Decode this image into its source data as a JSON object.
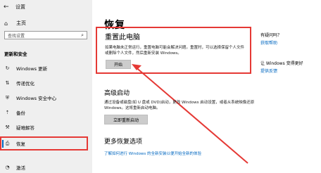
{
  "app": {
    "back_arrow": "←",
    "title": "设置"
  },
  "sidebar": {
    "home": {
      "icon": "home-icon",
      "glyph": "⌂",
      "label": "主页"
    },
    "search": {
      "placeholder": "查找设置",
      "icon": "search-icon",
      "glyph": "⌕"
    },
    "section_title": "更新和安全",
    "items": [
      {
        "icon": "refresh-icon",
        "glyph": "↻",
        "label": "Windows 更新"
      },
      {
        "icon": "delivery-optimization-icon",
        "glyph": "⇅",
        "label": "传递优化"
      },
      {
        "icon": "shield-icon",
        "glyph": "⛨",
        "label": "Windows 安全中心"
      },
      {
        "icon": "backup-icon",
        "glyph": "⇡",
        "label": "备份"
      },
      {
        "icon": "wrench-icon",
        "glyph": "⚒",
        "label": "疑难解答"
      },
      {
        "icon": "recovery-icon",
        "glyph": "⎙",
        "label": "恢复"
      },
      {
        "icon": "activation-icon",
        "glyph": "◔",
        "label": "激活"
      }
    ],
    "selected_index": 5
  },
  "main": {
    "title": "恢复",
    "reset": {
      "heading": "重置此电脑",
      "description": "如果电脑未正常运行，重置电脑可能会解决问题。重置时，可以选择保留个人文件或删除个人文件，然后重新安装 Windows。",
      "button": "开始"
    },
    "advanced": {
      "heading": "高级启动",
      "description": "通过设备或磁盘(如 U 盘或 DVD)启动，更改 Windows 启动设置，或者从系统映像还原 Windows。这将重新启动电脑。",
      "button": "立即重新启动"
    },
    "more": {
      "heading": "更多恢复选项",
      "link": "了解如何进行 Windows 的全新安装以便开始全新的体验"
    }
  },
  "right_panel": {
    "q1": "有疑问吗？",
    "link1": "获取帮助",
    "q2": "让 Windows 变得更好",
    "link2": "提供反馈"
  },
  "colors": {
    "highlight": "#e53935",
    "accent": "#0067c0",
    "sidebar_bg": "#efefef"
  }
}
